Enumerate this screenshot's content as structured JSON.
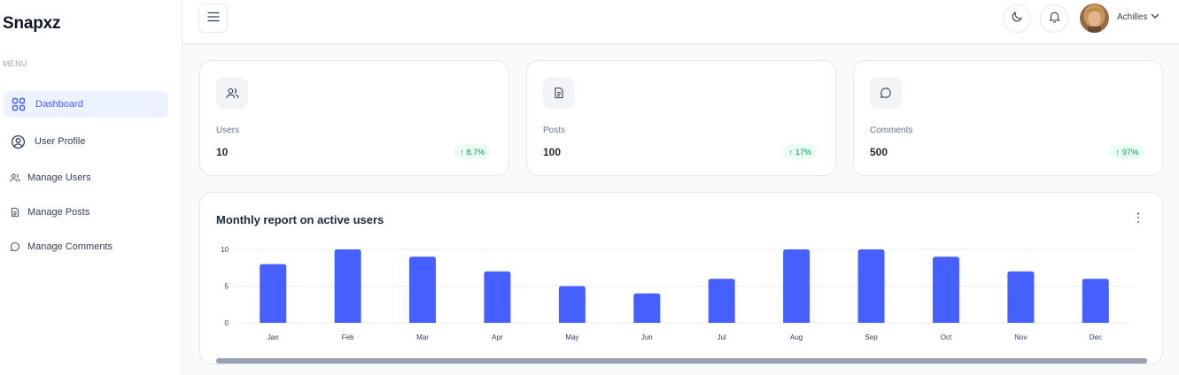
{
  "sidebar": {
    "logo": "Snapxz",
    "menu_label": "MENU",
    "items": [
      {
        "label": "Dashboard",
        "icon": "grid-icon",
        "active": true
      },
      {
        "label": "User Profile",
        "icon": "user-circle-icon",
        "active": false
      },
      {
        "label": "Manage Users",
        "icon": "users-icon",
        "active": false
      },
      {
        "label": "Manage Posts",
        "icon": "document-icon",
        "active": false
      },
      {
        "label": "Manage Comments",
        "icon": "comment-icon",
        "active": false
      }
    ]
  },
  "header": {
    "menu_icon": "hamburger-icon",
    "theme_icon": "moon-icon",
    "notification_icon": "bell-icon",
    "user_name": "Achilles"
  },
  "stats": [
    {
      "label": "Users",
      "value": "10",
      "change": "8.7%",
      "icon": "users-icon"
    },
    {
      "label": "Posts",
      "value": "100",
      "change": "17%",
      "icon": "document-icon"
    },
    {
      "label": "Comments",
      "value": "500",
      "change": "97%",
      "icon": "comment-icon"
    }
  ],
  "colors": {
    "accent": "#465fff",
    "positive": "#039855",
    "positive_bg": "#ecfdf3"
  },
  "chart_data": {
    "type": "bar",
    "title": "Monthly report on active users",
    "categories": [
      "Jan",
      "Feb",
      "Mar",
      "Apr",
      "May",
      "Jun",
      "Jul",
      "Aug",
      "Sep",
      "Oct",
      "Nov",
      "Dec"
    ],
    "values": [
      8,
      10,
      9,
      7,
      5,
      4,
      6,
      10,
      10,
      9,
      7,
      6
    ],
    "yticks": [
      "0",
      "5",
      "10"
    ],
    "ylim": [
      0,
      10
    ],
    "grid": true,
    "bar_color": "#465fff"
  }
}
